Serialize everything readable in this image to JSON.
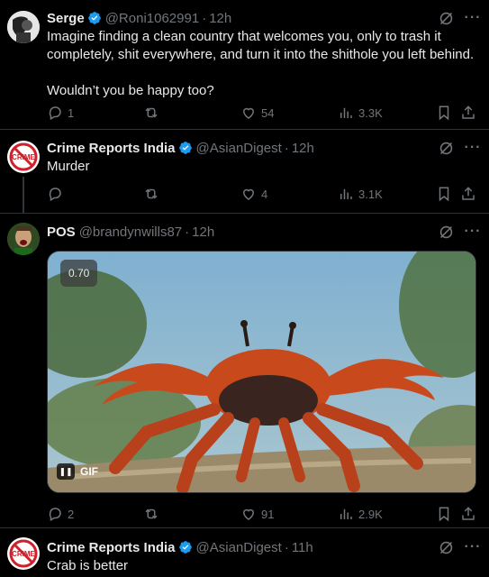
{
  "tweets": [
    {
      "name": "Serge",
      "handle": "@Roni1062991",
      "time": "12h",
      "text_lines": [
        "Imagine finding a clean country that welcomes you, only to trash it",
        "completely, shit everywhere, and turn it into the shithole you left behind.",
        "",
        "Wouldn’t you be happy too?"
      ],
      "replies": "1",
      "reposts": "",
      "likes": "54",
      "views": "3.3K"
    },
    {
      "name": "Crime Reports India",
      "handle": "@AsianDigest",
      "time": "12h",
      "text": "Murder",
      "replies": "",
      "reposts": "",
      "likes": "4",
      "views": "3.1K"
    },
    {
      "name": "POS",
      "handle": "@brandynwills87",
      "time": "12h",
      "media_badge": "0.70",
      "gif_label": "GIF",
      "replies": "2",
      "reposts": "",
      "likes": "91",
      "views": "2.9K"
    },
    {
      "name": "Crime Reports India",
      "handle": "@AsianDigest",
      "time": "11h",
      "text": "Crab is better"
    }
  ],
  "avatar_text": "CRIME",
  "dot": "·",
  "colors": {
    "accent": "#1d9bf0",
    "muted": "#71767b",
    "crab": "#c84a1c"
  }
}
